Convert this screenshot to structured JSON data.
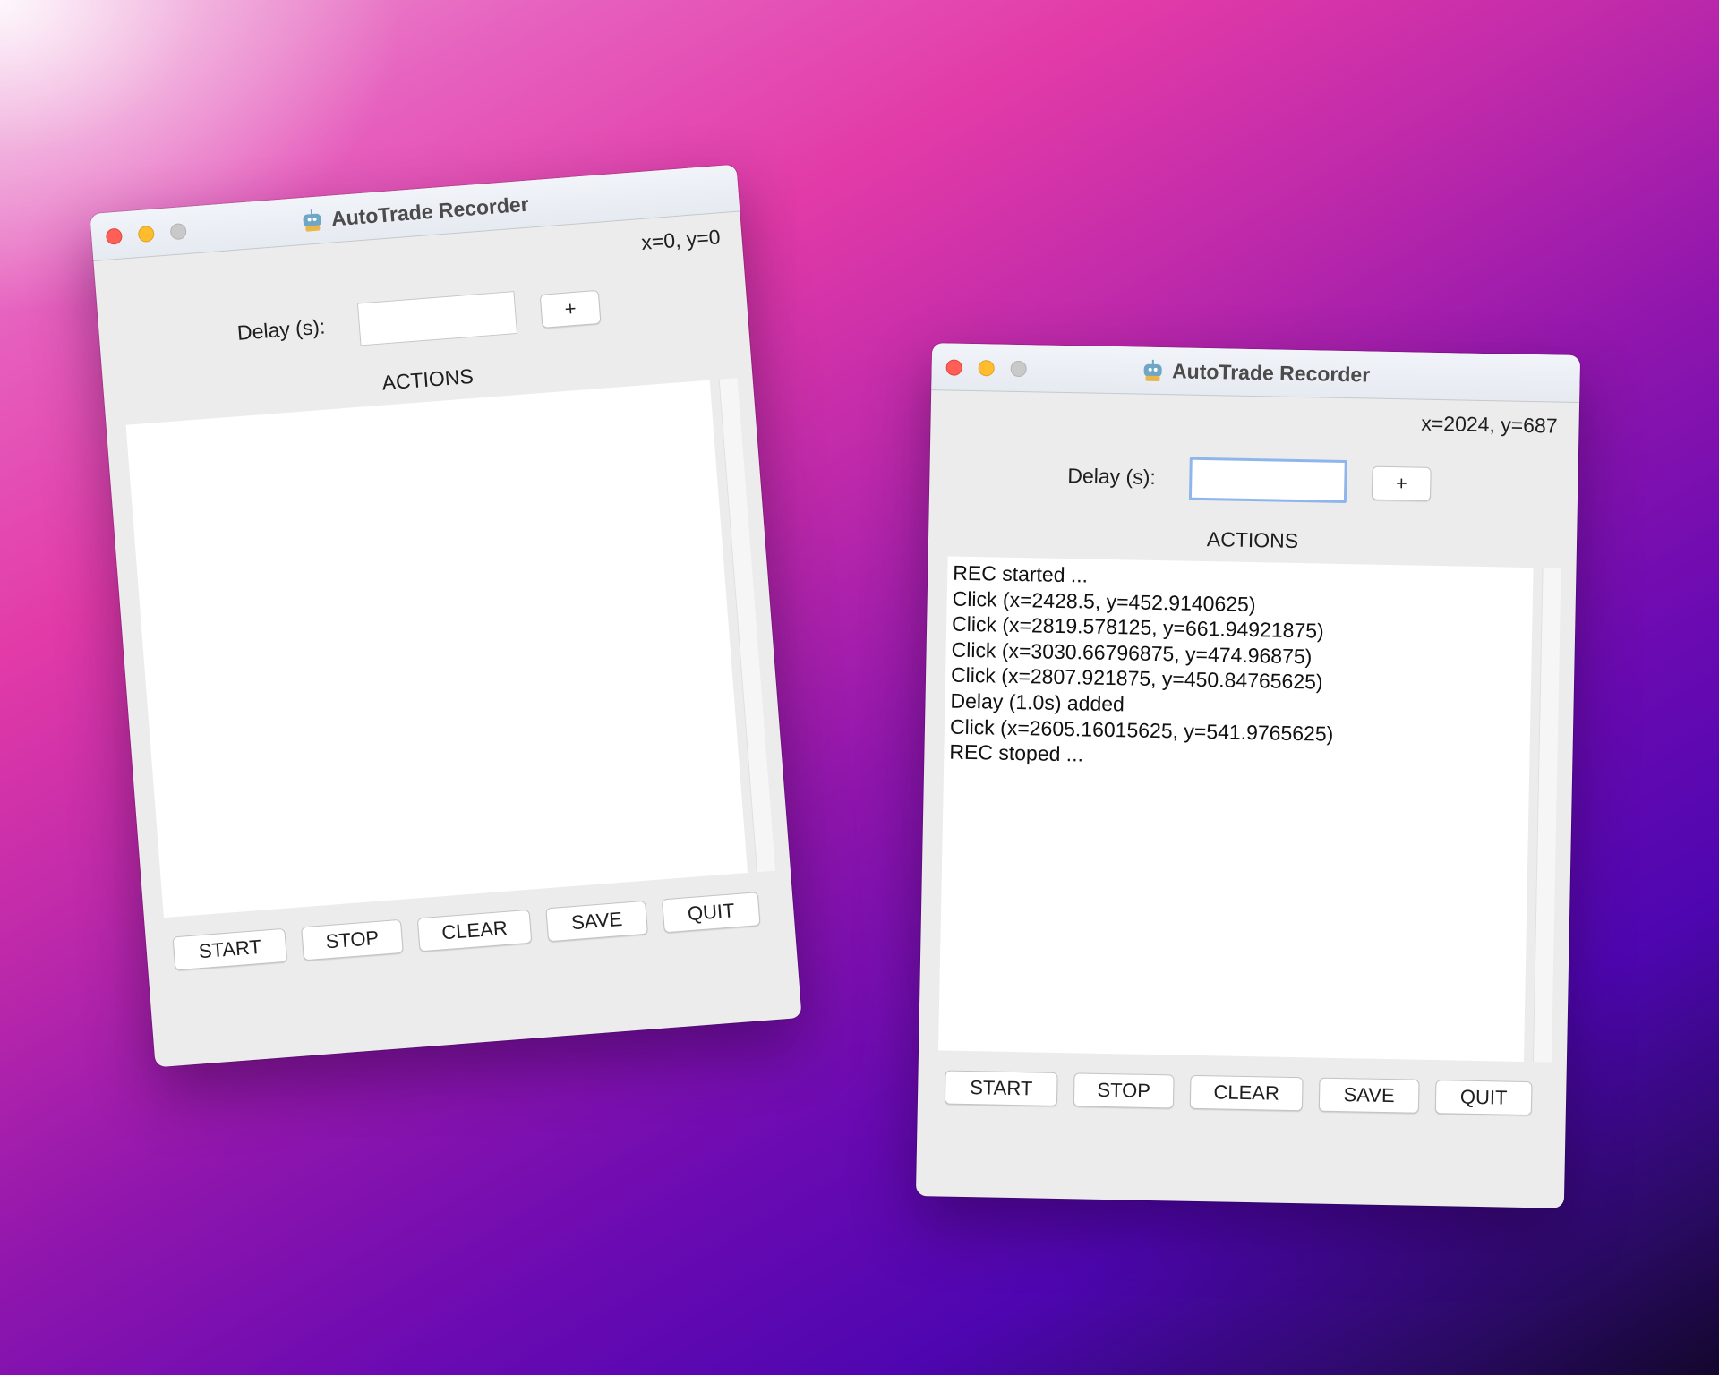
{
  "windows": [
    {
      "title": "AutoTrade Recorder",
      "coords": "x=0, y=0",
      "delay_label": "Delay (s):",
      "delay_value": "",
      "add_label": "+",
      "actions_label": "ACTIONS",
      "log": [],
      "buttons": {
        "start": "START",
        "stop": "STOP",
        "clear": "CLEAR",
        "save": "SAVE",
        "quit": "QUIT"
      }
    },
    {
      "title": "AutoTrade Recorder",
      "coords": "x=2024, y=687",
      "delay_label": "Delay (s):",
      "delay_value": "",
      "add_label": "+",
      "actions_label": "ACTIONS",
      "log": [
        "REC started ...",
        "Click (x=2428.5, y=452.9140625)",
        "Click (x=2819.578125, y=661.94921875)",
        "Click (x=3030.66796875, y=474.96875)",
        "Click (x=2807.921875, y=450.84765625)",
        "Delay (1.0s) added",
        "Click (x=2605.16015625, y=541.9765625)",
        "REC stoped ..."
      ],
      "buttons": {
        "start": "START",
        "stop": "STOP",
        "clear": "CLEAR",
        "save": "SAVE",
        "quit": "QUIT"
      }
    }
  ],
  "colors": {
    "close": "#ff5f57",
    "minimize": "#febc2e",
    "zoom_inactive": "#c9c9c9",
    "focus_ring": "#8fb6ec",
    "window_bg": "#ececec"
  },
  "icons": {
    "app": "robot-icon",
    "close": "close-dot-icon",
    "minimize": "minimize-dot-icon",
    "zoom": "zoom-dot-icon"
  }
}
